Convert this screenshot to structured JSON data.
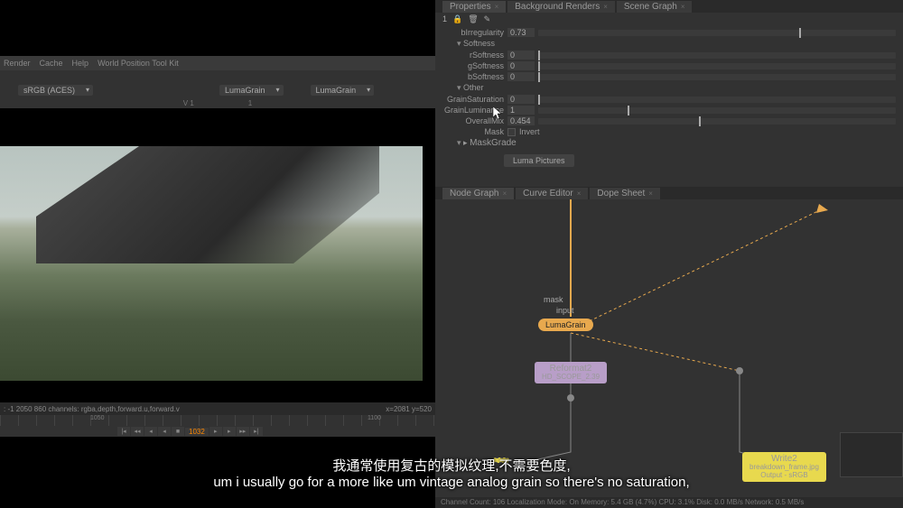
{
  "menubar": {
    "items": [
      "Render",
      "Cache",
      "Help",
      "World Position Tool Kit"
    ]
  },
  "toolbar2": {
    "colorspace": "sRGB (ACES)",
    "node1": "LumaGrain",
    "node2": "LumaGrain"
  },
  "tb3": {
    "left": "V 1",
    "right": "1"
  },
  "statusbar": {
    "left": ": -1 2050 860 channels: rgba,depth,forward.u,forward.v",
    "right": "x=2081 y=520"
  },
  "transport": {
    "frame": "1032"
  },
  "propsTabs": {
    "t1": "Properties",
    "t2": "Background Renders",
    "t3": "Scene Graph"
  },
  "propsToolbar": {
    "num": "1"
  },
  "params": {
    "bIrregularity": {
      "label": "bIrregularity",
      "val": "0.73"
    },
    "softness": "Softness",
    "rSoftness": {
      "label": "rSoftness",
      "val": "0"
    },
    "gSoftness": {
      "label": "gSoftness",
      "val": "0"
    },
    "bSoftness": {
      "label": "bSoftness",
      "val": "0"
    },
    "other": "Other",
    "grainSat": {
      "label": "GrainSaturation",
      "val": "0"
    },
    "grainLum": {
      "label": "GrainLuminance",
      "val": "1"
    },
    "overallMix": {
      "label": "OverallMix",
      "val": "0.454"
    },
    "mask": {
      "label": "Mask",
      "invert": "Invert"
    },
    "maskGrade": "MaskGrade",
    "lumaBtn": "Luma Pictures"
  },
  "graphTabs": {
    "t1": "Node Graph",
    "t2": "Curve Editor",
    "t3": "Dope Sheet"
  },
  "nodes": {
    "mask": "mask",
    "input": "input",
    "lumaGrain": "LumaGrain",
    "reformat": {
      "l1": "Reformat2",
      "l2": "HD_SCOPE_2.39"
    },
    "write": {
      "l1": "Write2",
      "l2": "breakdown_frame.jpg",
      "l3": "Output - sRGB"
    }
  },
  "footer": "Channel Count: 106 Localization Mode: On  Memory: 5.4 GB (4.7%)  CPU: 3.1%  Disk: 0.0 MB/s  Network: 0.5 MB/s",
  "subtitle": {
    "cn": "我通常使用复古的模拟纹理,不需要色度,",
    "en": "um i usually go for a more like um vintage analog grain so there's no saturation,"
  }
}
